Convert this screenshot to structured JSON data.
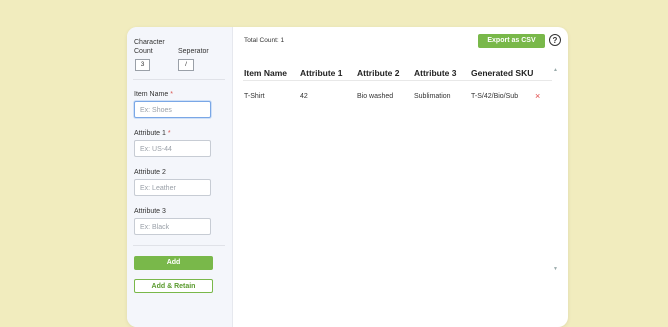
{
  "sidebar": {
    "char_count_label": "Character Count",
    "char_count_value": "3",
    "separator_label": "Seperator",
    "separator_value": "/",
    "item_name_label": "Item Name",
    "item_name_placeholder": "Ex: Shoes",
    "attr1_label": "Attribute 1",
    "attr1_placeholder": "Ex: US-44",
    "attr2_label": "Attribute 2",
    "attr2_placeholder": "Ex: Leather",
    "attr3_label": "Attribute 3",
    "attr3_placeholder": "Ex: Black",
    "add_label": "Add",
    "add_retain_label": "Add & Retain",
    "required_mark": "*"
  },
  "main": {
    "total_count": "Total Count: 1",
    "export_label": "Export as CSV",
    "help_symbol": "?",
    "columns": [
      "Item Name",
      "Attribute 1",
      "Attribute 2",
      "Attribute 3",
      "Generated SKU"
    ],
    "rows": [
      {
        "item": "T-Shirt",
        "attr1": "42",
        "attr2": "Bio washed",
        "attr3": "Sublimation",
        "sku": "T-S/42/Bio/Sub"
      }
    ],
    "delete_symbol": "×"
  },
  "colors": {
    "accent": "#79b84a",
    "background": "#f1ecbe",
    "delete": "#e04848"
  }
}
